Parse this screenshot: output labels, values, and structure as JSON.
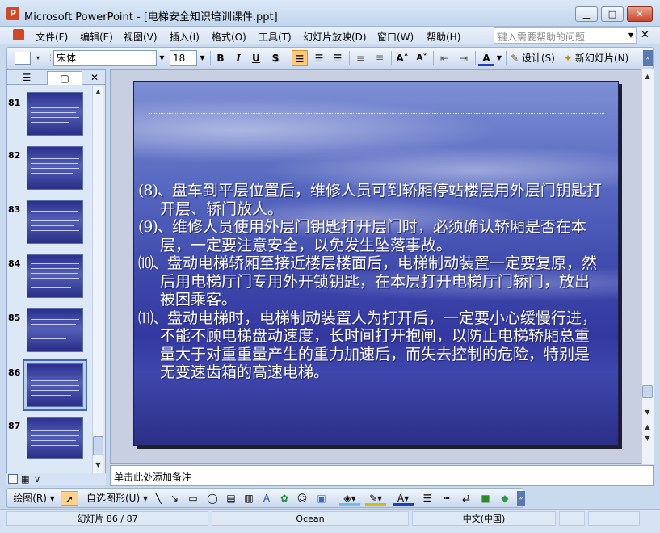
{
  "window": {
    "title": "Microsoft PowerPoint - [电梯安全知识培训课件.ppt]",
    "app_icon": "P"
  },
  "window_controls": {
    "min": "▁",
    "max": "□",
    "close": "✕"
  },
  "menu": [
    "文件(F)",
    "编辑(E)",
    "视图(V)",
    "插入(I)",
    "格式(O)",
    "工具(T)",
    "幻灯片放映(D)",
    "窗口(W)",
    "帮助(H)"
  ],
  "help": {
    "placeholder": "键入需要帮助的问题",
    "close": "✕"
  },
  "toolbar": {
    "font": "宋体",
    "size": "18",
    "bold": "B",
    "italic": "I",
    "underline": "U",
    "shadow": "S",
    "design": "设计(S)",
    "new_slide": "新幻灯片(N)"
  },
  "left_pane": {
    "tabs": [
      "outline-tab",
      "slides-tab"
    ],
    "close": "✕"
  },
  "thumbnails": [
    {
      "num": "81"
    },
    {
      "num": "82"
    },
    {
      "num": "83"
    },
    {
      "num": "84"
    },
    {
      "num": "85"
    },
    {
      "num": "86"
    },
    {
      "num": "87"
    }
  ],
  "slide": {
    "paragraphs": [
      {
        "num": "(8)、",
        "text": "盘车到平层位置后，维修人员可到轿厢停站楼层用外层门钥匙打开层、轿门放人。"
      },
      {
        "num": "(9)、",
        "text": "维修人员使用外层门钥匙打开层门时，必须确认轿厢是否在本层，一定要注意安全，以免发生坠落事故。"
      },
      {
        "num": "⑽、",
        "text": "盘动电梯轿厢至接近楼层楼面后，电梯制动装置一定要复原，然后用电梯厅门专用外开锁钥匙，在本层打开电梯厅门轿门，放出被困乘客。"
      },
      {
        "num": "⑾、",
        "text": "盘动电梯时，电梯制动装置人为打开后，一定要小心缓慢行进，不能不顾电梯盘动速度，长时间打开抱闸，以防止电梯轿厢总重量大于对重重量产生的重力加速后，而失去控制的危险，特别是无变速齿箱的高速电梯。"
      }
    ]
  },
  "notes": {
    "placeholder": "单击此处添加备注"
  },
  "drawing": {
    "draw": "绘图(R)",
    "autoshapes": "自选图形(U)"
  },
  "status": {
    "slide": "幻灯片 86 / 87",
    "design": "Ocean",
    "language": "中文(中国)"
  },
  "colors": {
    "accent": "#4266b4",
    "slide_blue": "#3338a0"
  }
}
